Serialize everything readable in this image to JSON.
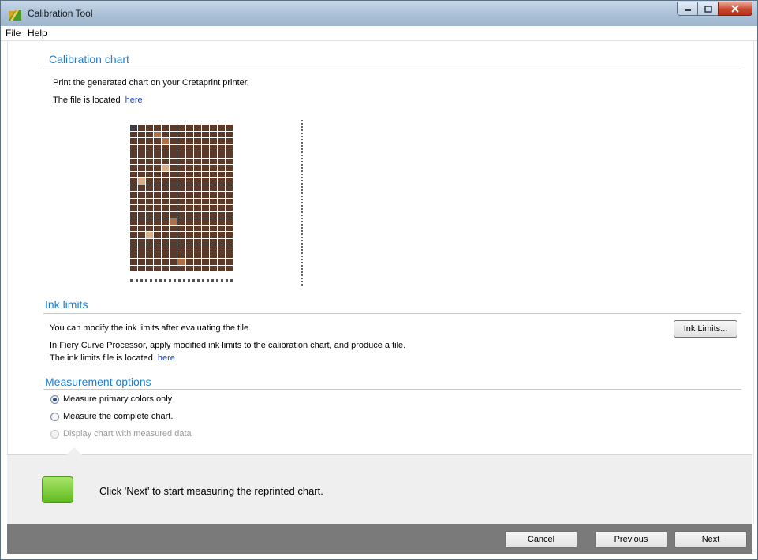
{
  "window": {
    "title": "Calibration Tool"
  },
  "menu": {
    "file": "File",
    "help": "Help"
  },
  "calibration": {
    "title": "Calibration chart",
    "line1": "Print the generated chart on your Cretaprint printer.",
    "line2": "The file is located",
    "link": "here"
  },
  "ink": {
    "title": "Ink limits",
    "line1": "You can modify the ink limits after evaluating the tile.",
    "line2": "In Fiery Curve Processor, apply modified ink limits to the calibration chart, and produce a tile.",
    "line3": "The ink limits file is located",
    "link": "here",
    "button": "Ink Limits..."
  },
  "measurement": {
    "title": "Measurement options",
    "options": [
      {
        "label": "Measure primary colors only",
        "checked": true,
        "enabled": true
      },
      {
        "label": "Measure the complete chart.",
        "checked": false,
        "enabled": true
      },
      {
        "label": "Display chart with measured data",
        "checked": false,
        "enabled": false
      }
    ]
  },
  "status": {
    "message": "Click 'Next' to start measuring the reprinted chart.",
    "color": "#6cc424"
  },
  "footer": {
    "cancel": "Cancel",
    "previous": "Previous",
    "next": "Next"
  },
  "colors": {
    "accent": "#1c7fd4",
    "link": "#1a3fc7"
  }
}
